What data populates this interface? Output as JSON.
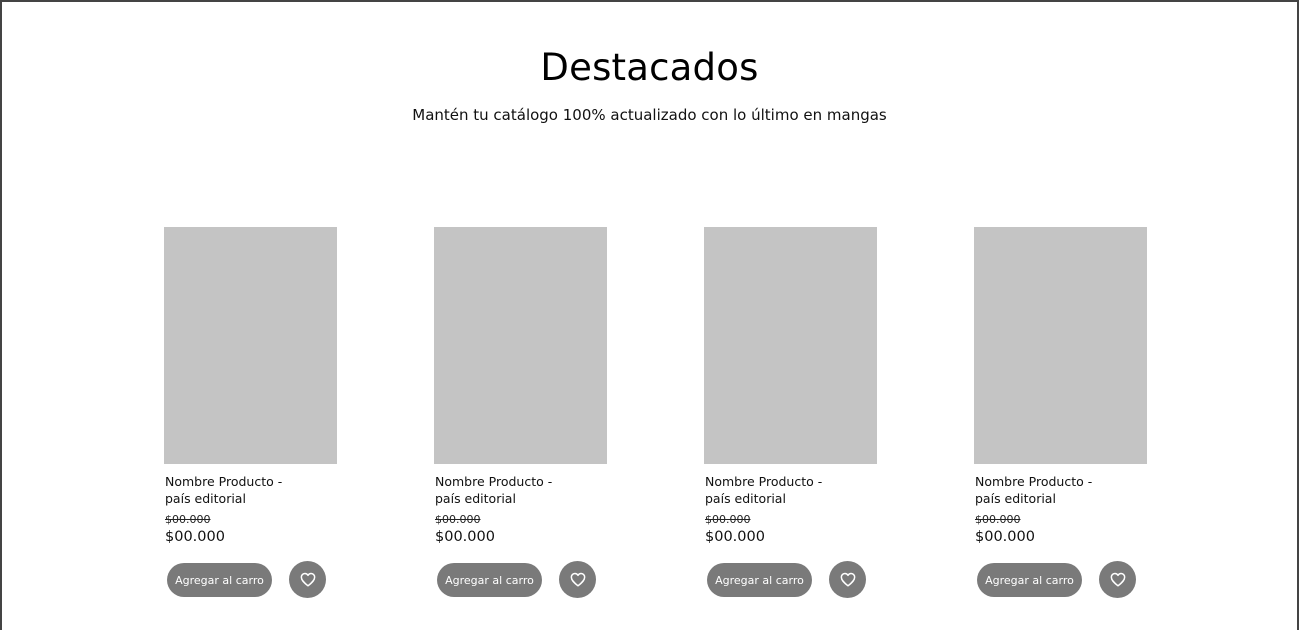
{
  "section": {
    "title": "Destacados",
    "subtitle": "Mantén tu catálogo 100% actualizado con lo último en mangas"
  },
  "products": [
    {
      "name_line1": "Nombre Producto -",
      "name_line2": "país editorial",
      "old_price": "$00.000",
      "price": "$00.000",
      "cart_label": "Agregar al carro",
      "favorite_icon": "heart-icon"
    },
    {
      "name_line1": "Nombre Producto -",
      "name_line2": "país editorial",
      "old_price": "$00.000",
      "price": "$00.000",
      "cart_label": "Agregar al carro",
      "favorite_icon": "heart-icon"
    },
    {
      "name_line1": "Nombre Producto -",
      "name_line2": "país editorial",
      "old_price": "$00.000",
      "price": "$00.000",
      "cart_label": "Agregar al carro",
      "favorite_icon": "heart-icon"
    },
    {
      "name_line1": "Nombre Producto -",
      "name_line2": "país editorial",
      "old_price": "$00.000",
      "price": "$00.000",
      "cart_label": "Agregar al carro",
      "favorite_icon": "heart-icon"
    }
  ],
  "colors": {
    "placeholder_image": "#c4c4c4",
    "button_background": "#7a7a7a",
    "button_text": "#ffffff"
  }
}
